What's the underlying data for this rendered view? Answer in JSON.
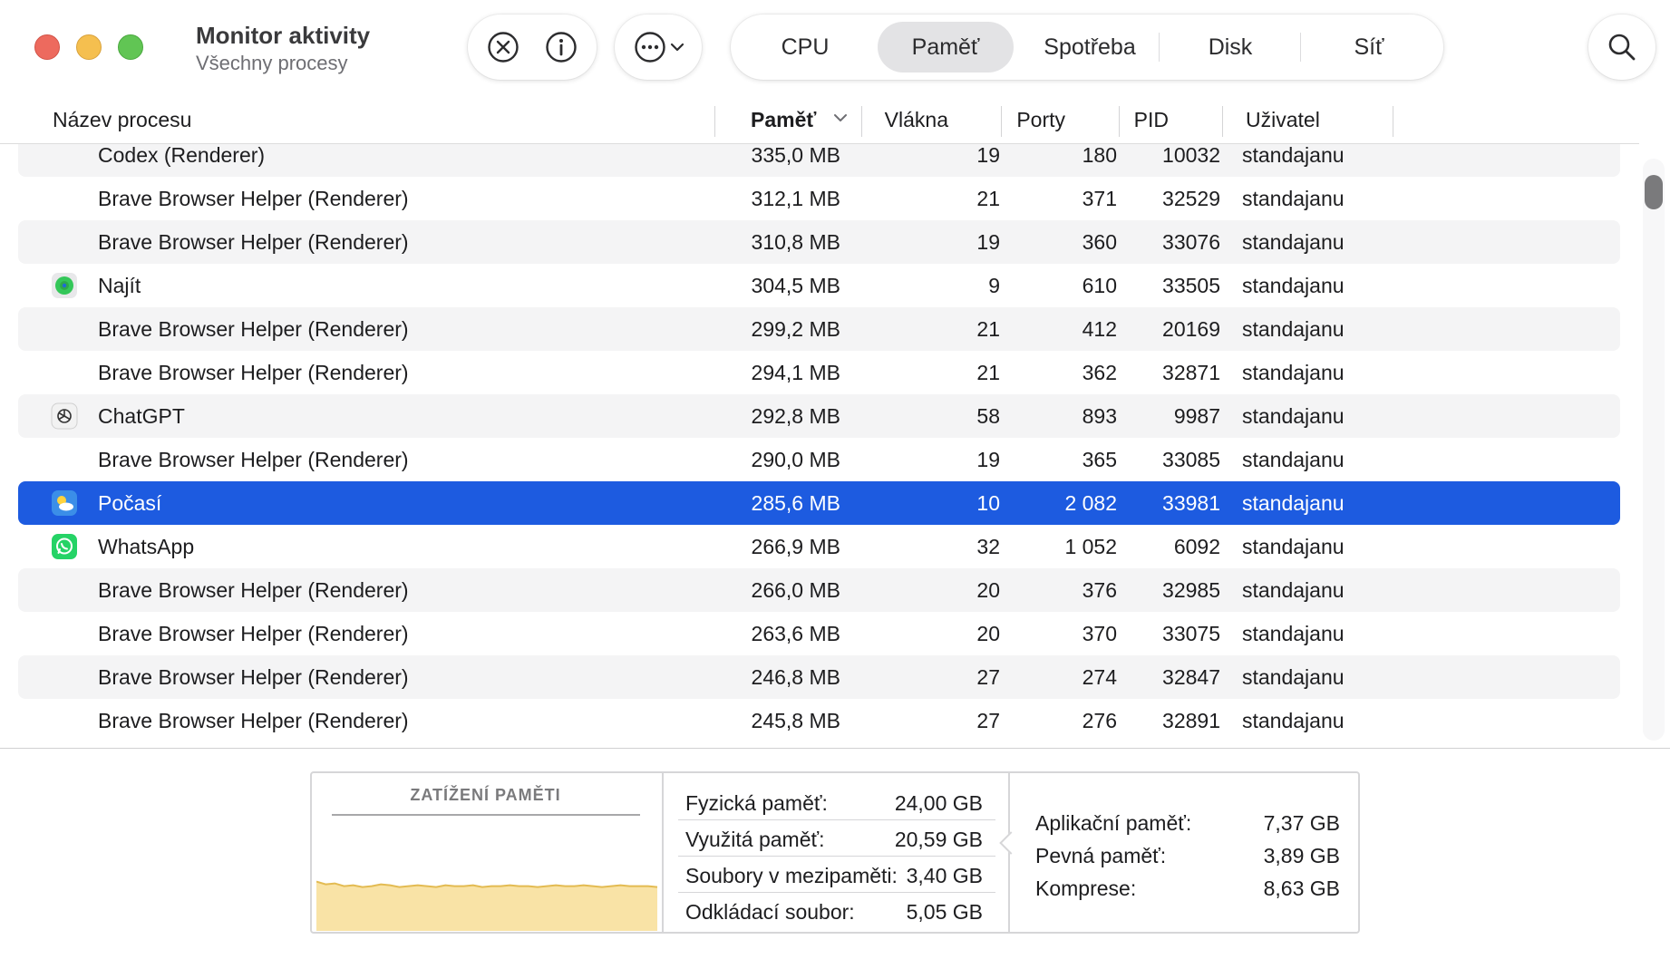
{
  "window": {
    "title": "Monitor aktivity",
    "subtitle": "Všechny procesy"
  },
  "toolbar": {
    "stop_icon": "xmark-circle-icon",
    "info_icon": "info-circle-icon",
    "more_icon": "ellipsis-circle-icon",
    "tabs": [
      "CPU",
      "Paměť",
      "Spotřeba",
      "Disk",
      "Síť"
    ],
    "active_tab": "Paměť",
    "search_icon": "magnifying-glass-icon"
  },
  "table": {
    "columns": [
      "Název procesu",
      "Paměť",
      "Vlákna",
      "Porty",
      "PID",
      "Uživatel"
    ],
    "sorted_column": "Paměť",
    "sort_direction": "descending",
    "selected_row": 8,
    "rows": [
      {
        "name": "Codex (Renderer)",
        "icon": "",
        "memory": "335,0 MB",
        "threads": "19",
        "ports": "180",
        "pid": "10032",
        "user": "standajanu"
      },
      {
        "name": "Brave Browser Helper (Renderer)",
        "icon": "",
        "memory": "312,1 MB",
        "threads": "21",
        "ports": "371",
        "pid": "32529",
        "user": "standajanu"
      },
      {
        "name": "Brave Browser Helper (Renderer)",
        "icon": "",
        "memory": "310,8 MB",
        "threads": "19",
        "ports": "360",
        "pid": "33076",
        "user": "standajanu"
      },
      {
        "name": "Najít",
        "icon": "find-my-icon",
        "memory": "304,5 MB",
        "threads": "9",
        "ports": "610",
        "pid": "33505",
        "user": "standajanu"
      },
      {
        "name": "Brave Browser Helper (Renderer)",
        "icon": "",
        "memory": "299,2 MB",
        "threads": "21",
        "ports": "412",
        "pid": "20169",
        "user": "standajanu"
      },
      {
        "name": "Brave Browser Helper (Renderer)",
        "icon": "",
        "memory": "294,1 MB",
        "threads": "21",
        "ports": "362",
        "pid": "32871",
        "user": "standajanu"
      },
      {
        "name": "ChatGPT",
        "icon": "chatgpt-icon",
        "memory": "292,8 MB",
        "threads": "58",
        "ports": "893",
        "pid": "9987",
        "user": "standajanu"
      },
      {
        "name": "Brave Browser Helper (Renderer)",
        "icon": "",
        "memory": "290,0 MB",
        "threads": "19",
        "ports": "365",
        "pid": "33085",
        "user": "standajanu"
      },
      {
        "name": "Počasí",
        "icon": "weather-icon",
        "memory": "285,6 MB",
        "threads": "10",
        "ports": "2 082",
        "pid": "33981",
        "user": "standajanu"
      },
      {
        "name": "WhatsApp",
        "icon": "whatsapp-icon",
        "memory": "266,9 MB",
        "threads": "32",
        "ports": "1 052",
        "pid": "6092",
        "user": "standajanu"
      },
      {
        "name": "Brave Browser Helper (Renderer)",
        "icon": "",
        "memory": "266,0 MB",
        "threads": "20",
        "ports": "376",
        "pid": "32985",
        "user": "standajanu"
      },
      {
        "name": "Brave Browser Helper (Renderer)",
        "icon": "",
        "memory": "263,6 MB",
        "threads": "20",
        "ports": "370",
        "pid": "33075",
        "user": "standajanu"
      },
      {
        "name": "Brave Browser Helper (Renderer)",
        "icon": "",
        "memory": "246,8 MB",
        "threads": "27",
        "ports": "274",
        "pid": "32847",
        "user": "standajanu"
      },
      {
        "name": "Brave Browser Helper (Renderer)",
        "icon": "",
        "memory": "245,8 MB",
        "threads": "27",
        "ports": "276",
        "pid": "32891",
        "user": "standajanu"
      }
    ]
  },
  "memory_panel": {
    "pressure_title": "ZATÍŽENÍ PAMĚTI",
    "pressure_color": "#f9e3a6",
    "pressure_stroke": "#e3bb52",
    "pressure_level": 0.36,
    "left_stats": [
      {
        "label": "Fyzická paměť:",
        "value": "24,00 GB"
      },
      {
        "label": "Využitá paměť:",
        "value": "20,59 GB"
      },
      {
        "label": "Soubory v mezipaměti:",
        "value": "3,40 GB"
      },
      {
        "label": "Odkládací soubor:",
        "value": "5,05 GB"
      }
    ],
    "right_stats": [
      {
        "label": "Aplikační paměť:",
        "value": "7,37 GB"
      },
      {
        "label": "Pevná paměť:",
        "value": "3,89 GB"
      },
      {
        "label": "Komprese:",
        "value": "8,63 GB"
      }
    ]
  },
  "colors": {
    "selection": "#1d5be0",
    "stripe": "#f4f4f5"
  }
}
